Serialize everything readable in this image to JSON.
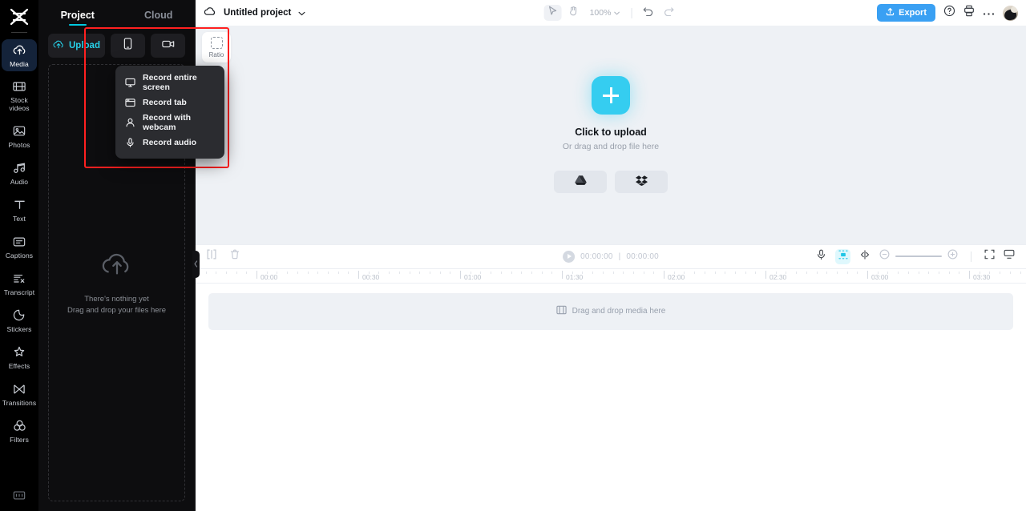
{
  "app": {
    "logo": "capcut-logo"
  },
  "rail": {
    "items": [
      {
        "label": "Media",
        "icon": "cloud-upload-icon",
        "active": true
      },
      {
        "label": "Stock\nvideos",
        "icon": "film-strip-icon",
        "active": false
      },
      {
        "label": "Photos",
        "icon": "image-icon",
        "active": false
      },
      {
        "label": "Audio",
        "icon": "music-note-icon",
        "active": false
      },
      {
        "label": "Text",
        "icon": "text-t-icon",
        "active": false
      },
      {
        "label": "Captions",
        "icon": "captions-icon",
        "active": false
      },
      {
        "label": "Transcript",
        "icon": "transcript-icon",
        "active": false
      },
      {
        "label": "Stickers",
        "icon": "sticker-icon",
        "active": false
      },
      {
        "label": "Effects",
        "icon": "sparkle-icon",
        "active": false
      },
      {
        "label": "Transitions",
        "icon": "transitions-icon",
        "active": false
      },
      {
        "label": "Filters",
        "icon": "filters-circles-icon",
        "active": false
      }
    ],
    "bottom": {
      "label": "keyboard-shortcuts",
      "icon": "keyboard-icon"
    }
  },
  "panel": {
    "tabs": [
      {
        "label": "Project",
        "active": true
      },
      {
        "label": "Cloud",
        "active": false
      }
    ],
    "upload_label": "Upload",
    "upload_icon": "cloud-upload-icon",
    "phone_icon": "mobile-phone-icon",
    "record_icon": "video-camera-icon",
    "empty": {
      "icon": "cloud-upload-large-icon",
      "line1": "There's nothing yet",
      "line2": "Drag and drop your files here"
    },
    "record_menu": [
      {
        "label": "Record entire screen",
        "icon": "monitor-icon"
      },
      {
        "label": "Record tab",
        "icon": "browser-tab-icon"
      },
      {
        "label": "Record with webcam",
        "icon": "person-icon"
      },
      {
        "label": "Record audio",
        "icon": "microphone-icon"
      }
    ],
    "collapse_icon": "chevron-left-icon",
    "highlight_color": "#ff2020"
  },
  "topbar": {
    "cloud_icon": "cloud-icon",
    "project_name": "Untitled project",
    "project_caret": "chevron-down-icon",
    "select_tool_icon": "cursor-arrow-icon",
    "hand_tool_icon": "hand-icon",
    "zoom_level": "100%",
    "zoom_caret": "chevron-down-icon",
    "undo_icon": "undo-arrow-icon",
    "redo_icon": "redo-arrow-icon",
    "export_label": "Export",
    "export_icon": "export-upload-icon",
    "export_color": "#3aa0f3",
    "help_icon": "question-circle-icon",
    "print_icon": "printer-icon",
    "more_icon": "ellipsis-icon",
    "avatar": "user-avatar"
  },
  "preview": {
    "ratio_label": "Ratio",
    "ratio_icon": "aspect-ratio-icon",
    "plus_icon": "plus-icon",
    "title": "Click to upload",
    "subtitle": "Or drag and drop file here",
    "cloud_sources": [
      {
        "name": "google-drive",
        "icon": "google-drive-icon"
      },
      {
        "name": "dropbox",
        "icon": "dropbox-icon"
      }
    ],
    "accent_color": "#35cdf0"
  },
  "timeline": {
    "split_icon": "split-clip-icon",
    "delete_icon": "trash-icon",
    "play_icon": "play-icon",
    "current_time": "00:00:00",
    "time_separator": "|",
    "total_time": "00:00:00",
    "mic_icon": "microphone-icon",
    "snap_icon": "snap-magnet-icon",
    "snap_active": true,
    "snap_color": "#1fc6e6",
    "mirror_icon": "mirror-split-icon",
    "zoom_out_icon": "zoom-minus-icon",
    "zoom_in_icon": "zoom-plus-icon",
    "fit_icon": "fit-screen-icon",
    "display_icon": "display-icon",
    "ruler_labels": [
      "00:00",
      "00:30",
      "01:00",
      "01:30",
      "02:00",
      "02:30",
      "03:00",
      "03:30"
    ],
    "ruler_positions": [
      320,
      447,
      574,
      701,
      828,
      955,
      1082,
      1209
    ],
    "drop_track_label": "Drag and drop media here",
    "drop_track_icon": "film-strip-icon"
  }
}
